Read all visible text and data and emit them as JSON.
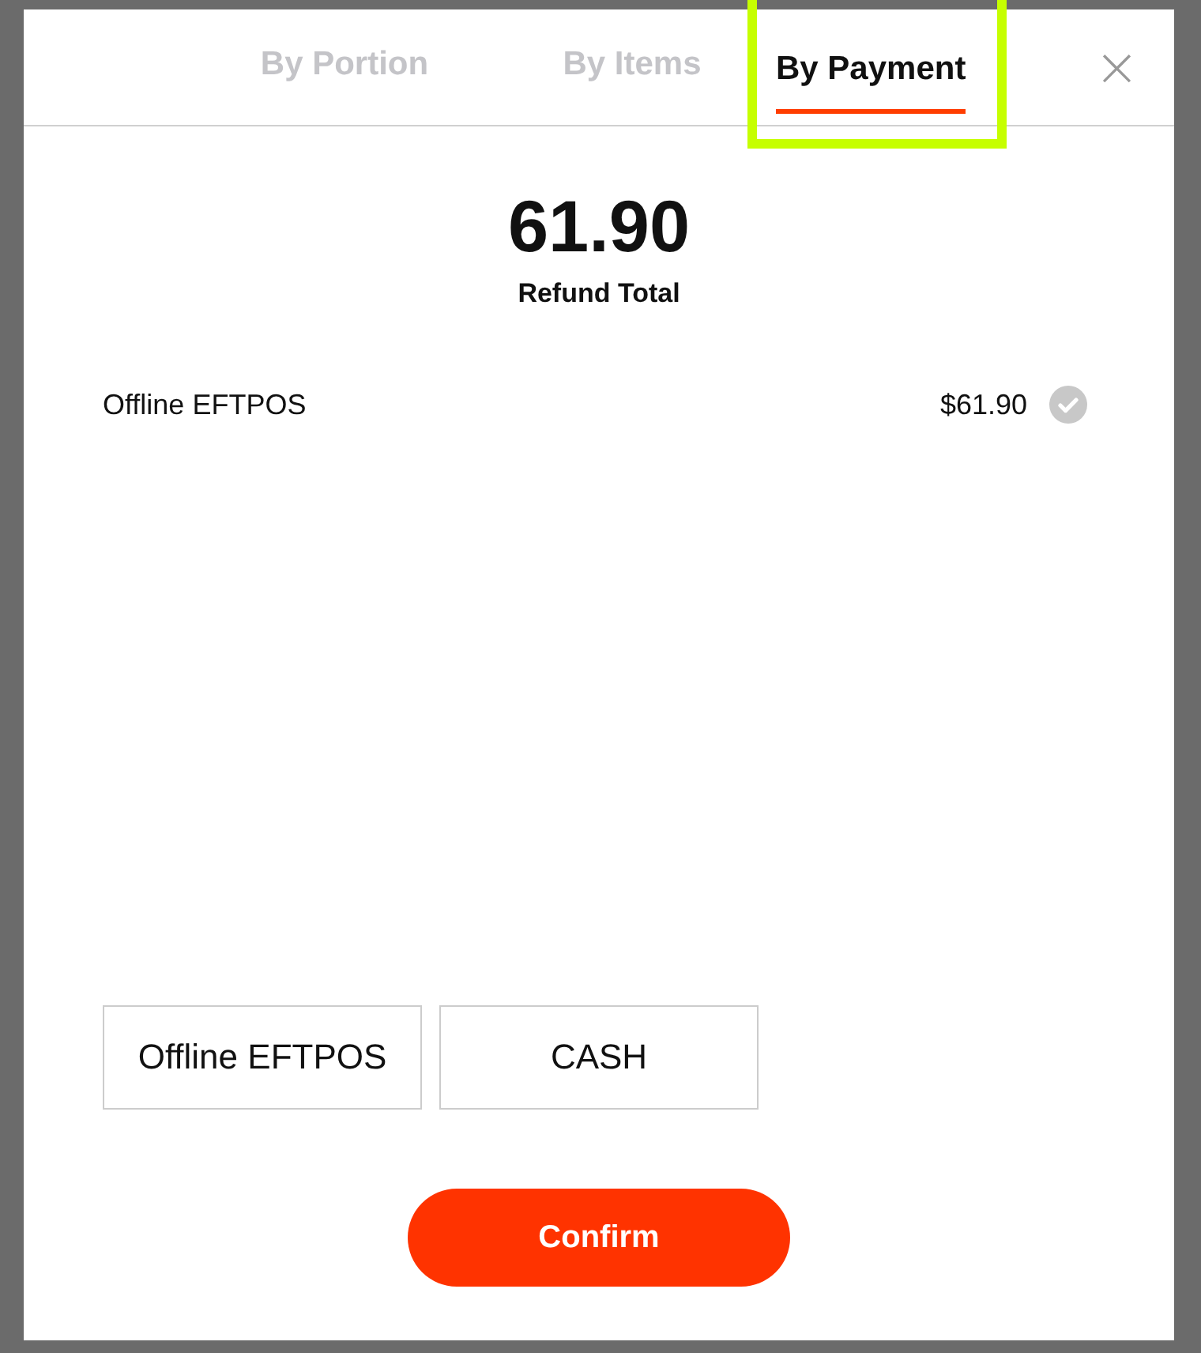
{
  "tabs": [
    {
      "label": "By Portion",
      "selected": false,
      "highlighted": false
    },
    {
      "label": "By Items",
      "selected": false,
      "highlighted": false
    },
    {
      "label": "By Payment",
      "selected": true,
      "highlighted": true
    }
  ],
  "close": "×",
  "total": {
    "amount": "61.90",
    "label": "Refund Total"
  },
  "payments": [
    {
      "method": "Offline EFTPOS",
      "amount": "$61.90",
      "checked": true
    }
  ],
  "methods": [
    "Offline EFTPOS",
    "CASH"
  ],
  "confirm": "Confirm"
}
